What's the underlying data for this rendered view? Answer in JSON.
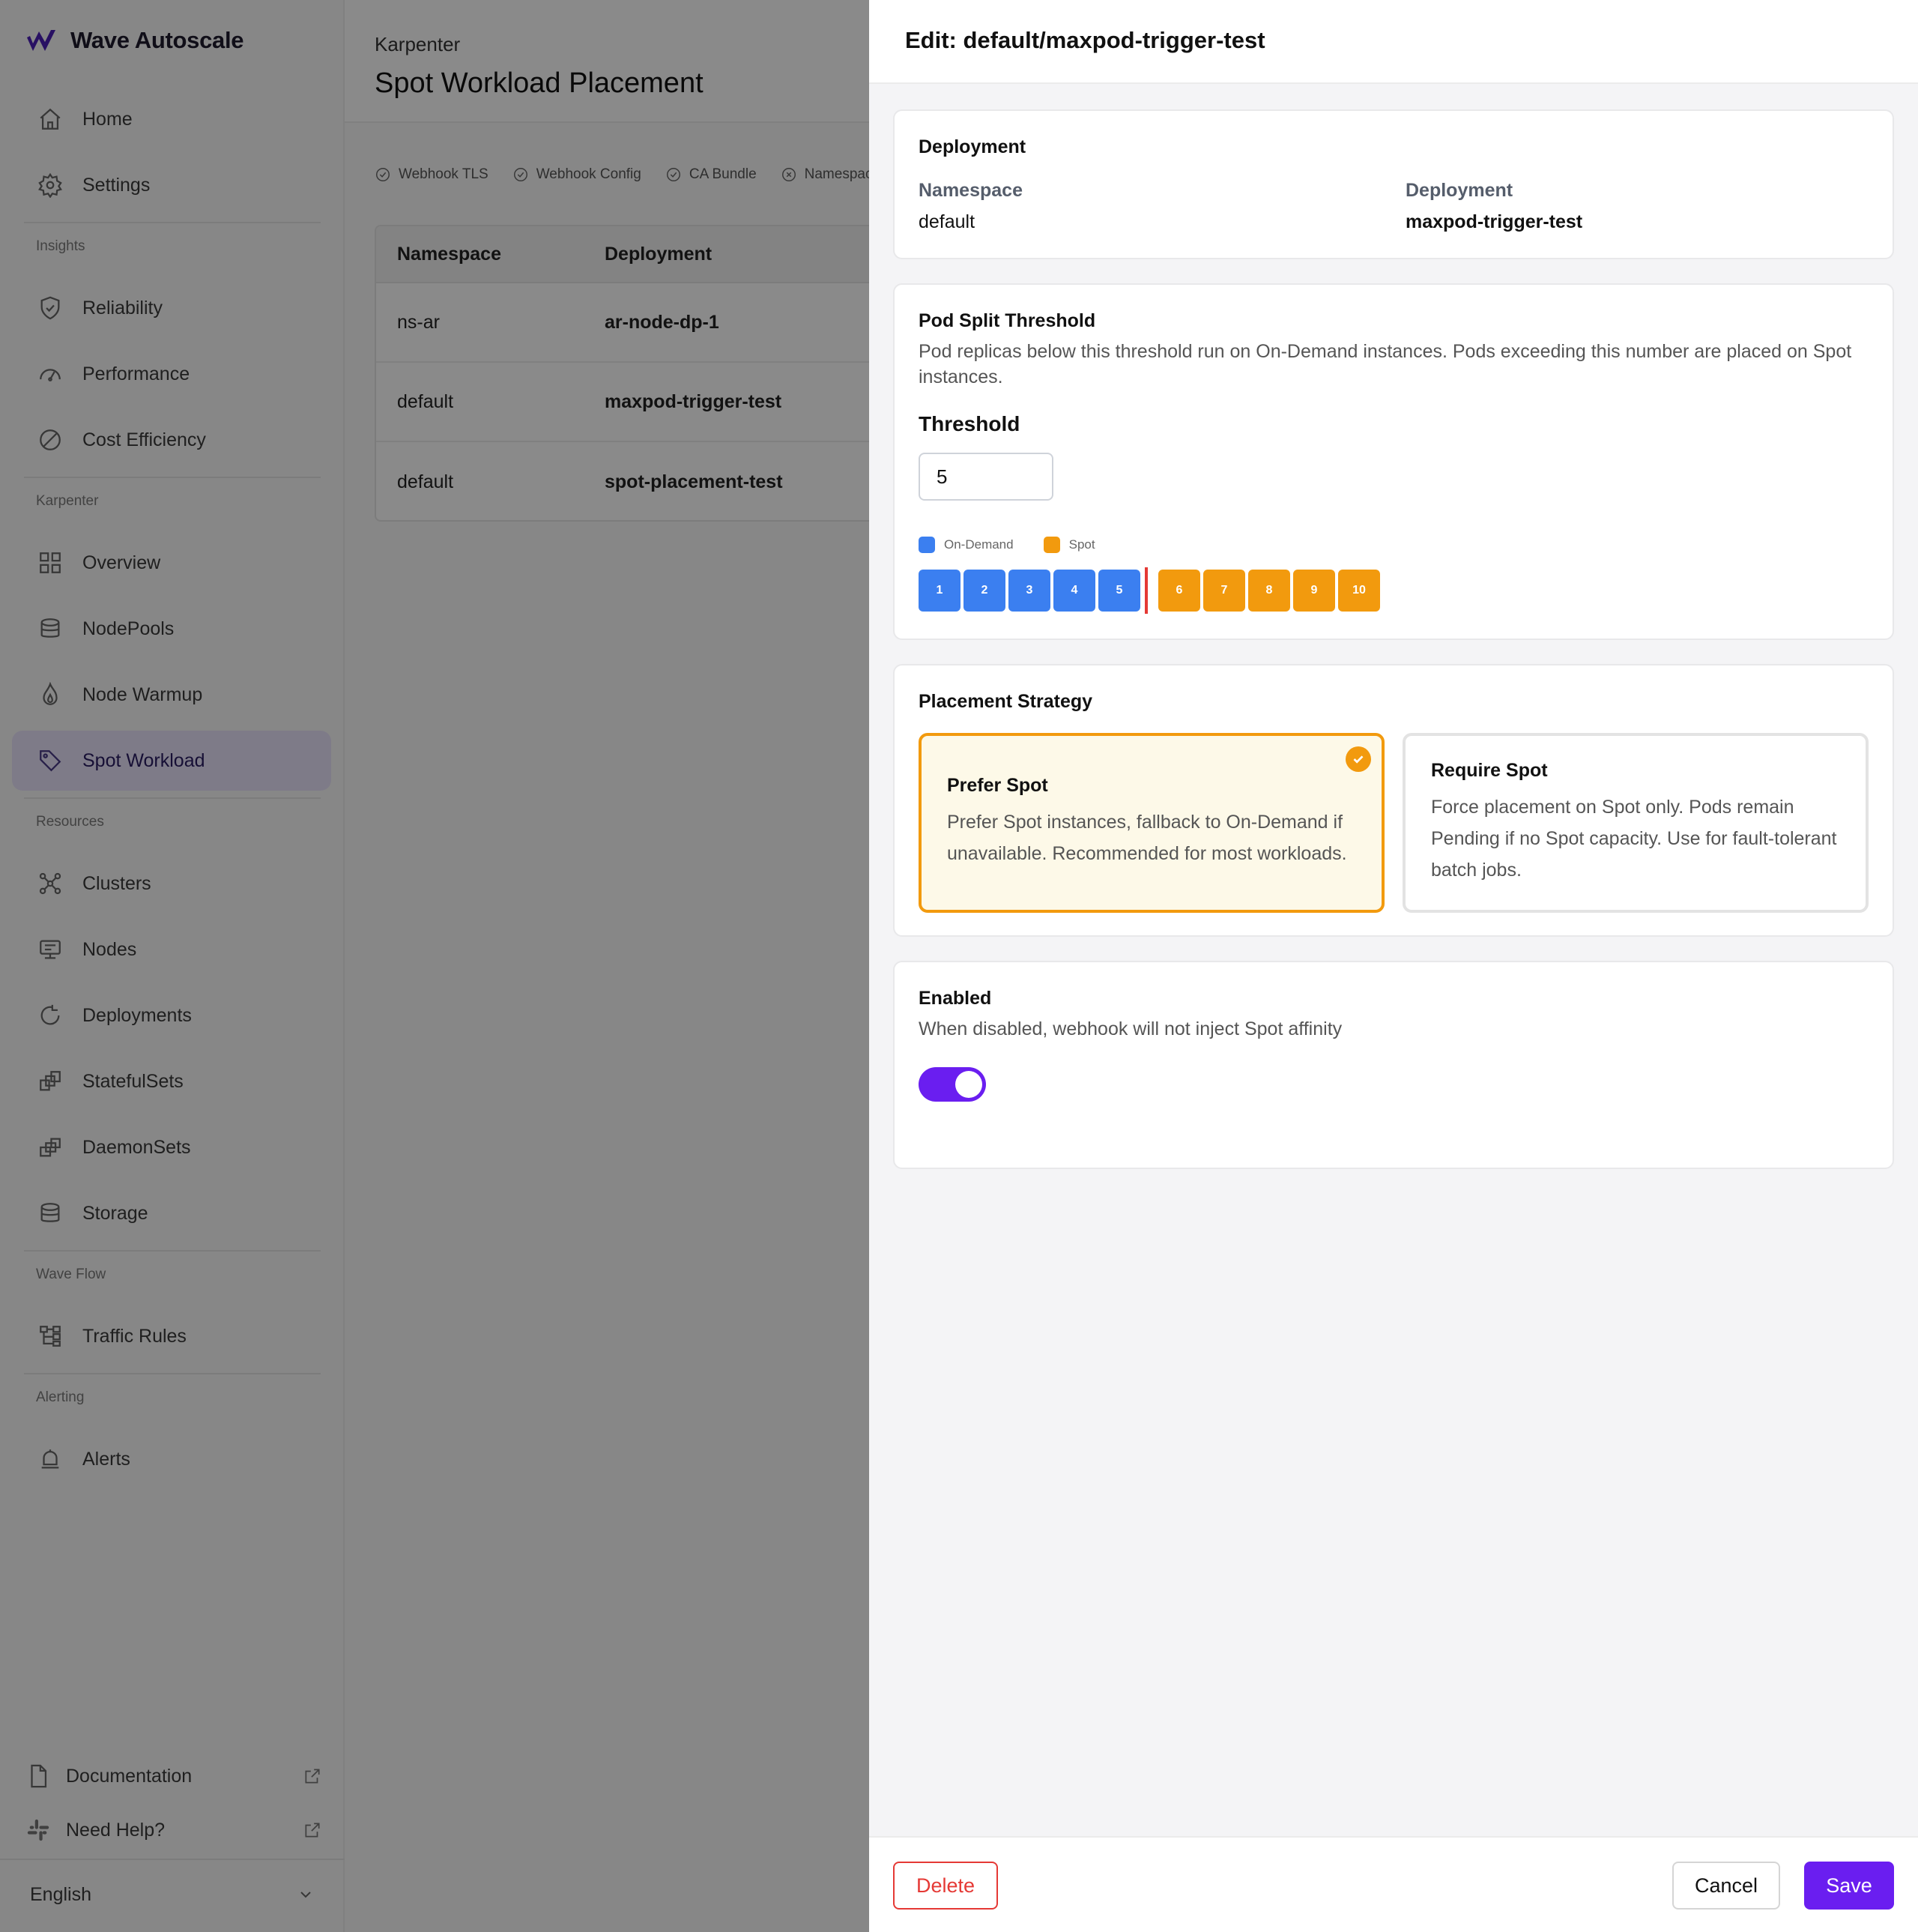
{
  "brand": {
    "name": "Wave Autoscale"
  },
  "sidebar": {
    "items": [
      {
        "label": "Home",
        "icon": "home-icon"
      },
      {
        "label": "Settings",
        "icon": "gear-icon"
      },
      {
        "label": "Reliability",
        "icon": "shield-icon"
      },
      {
        "label": "Performance",
        "icon": "gauge-icon"
      },
      {
        "label": "Cost Efficiency",
        "icon": "cost-icon"
      },
      {
        "label": "Overview",
        "icon": "grid-icon"
      },
      {
        "label": "NodePools",
        "icon": "database-icon"
      },
      {
        "label": "Node Warmup",
        "icon": "flame-icon"
      },
      {
        "label": "Spot Workload",
        "icon": "tag-icon"
      },
      {
        "label": "Clusters",
        "icon": "cluster-icon"
      },
      {
        "label": "Nodes",
        "icon": "node-icon"
      },
      {
        "label": "Deployments",
        "icon": "deployment-icon"
      },
      {
        "label": "StatefulSets",
        "icon": "statefulset-icon"
      },
      {
        "label": "DaemonSets",
        "icon": "daemonset-icon"
      },
      {
        "label": "Storage",
        "icon": "storage-icon"
      },
      {
        "label": "Traffic Rules",
        "icon": "traffic-icon"
      },
      {
        "label": "Alerts",
        "icon": "bell-icon"
      }
    ],
    "sections": [
      "Insights",
      "Karpenter",
      "Resources",
      "Wave Flow",
      "Alerting"
    ],
    "footer": {
      "documentation": "Documentation",
      "help": "Need Help?",
      "language": "English"
    }
  },
  "page": {
    "breadcrumb": "Karpenter",
    "title": "Spot Workload Placement",
    "status": [
      "Webhook TLS",
      "Webhook Config",
      "CA Bundle",
      "Namespace S"
    ],
    "table": {
      "headers": [
        "Namespace",
        "Deployment"
      ],
      "rows": [
        {
          "namespace": "ns-ar",
          "deployment": "ar-node-dp-1"
        },
        {
          "namespace": "default",
          "deployment": "maxpod-trigger-test"
        },
        {
          "namespace": "default",
          "deployment": "spot-placement-test"
        }
      ]
    }
  },
  "drawer": {
    "title": "Edit: default/maxpod-trigger-test",
    "deployment_card": {
      "title": "Deployment",
      "namespace_label": "Namespace",
      "namespace_value": "default",
      "deployment_label": "Deployment",
      "deployment_value": "maxpod-trigger-test"
    },
    "threshold_card": {
      "title": "Pod Split Threshold",
      "description": "Pod replicas below this threshold run on On-Demand instances. Pods exceeding this number are placed on Spot instances.",
      "label": "Threshold",
      "value": "5",
      "legend_on_demand": "On-Demand",
      "legend_spot": "Spot",
      "pods": [
        "1",
        "2",
        "3",
        "4",
        "5",
        "6",
        "7",
        "8",
        "9",
        "10"
      ],
      "threshold": 5,
      "on_demand_color": "#3b7ff0",
      "spot_color": "#f29a0e"
    },
    "strategy_card": {
      "title": "Placement Strategy",
      "prefer_title": "Prefer Spot",
      "prefer_desc": "Prefer Spot instances, fallback to On-Demand if unavailable. Recommended for most workloads.",
      "require_title": "Require Spot",
      "require_desc": "Force placement on Spot only. Pods remain Pending if no Spot capacity. Use for fault-tolerant batch jobs.",
      "selected": "Prefer Spot"
    },
    "enabled_card": {
      "title": "Enabled",
      "description": "When disabled, webhook will not inject Spot affinity",
      "enabled": true
    },
    "footer": {
      "delete": "Delete",
      "cancel": "Cancel",
      "save": "Save"
    }
  },
  "colors": {
    "accent": "#6a1ef0",
    "danger": "#e53935",
    "warning": "#f29a0e",
    "info": "#3b7ff0"
  }
}
